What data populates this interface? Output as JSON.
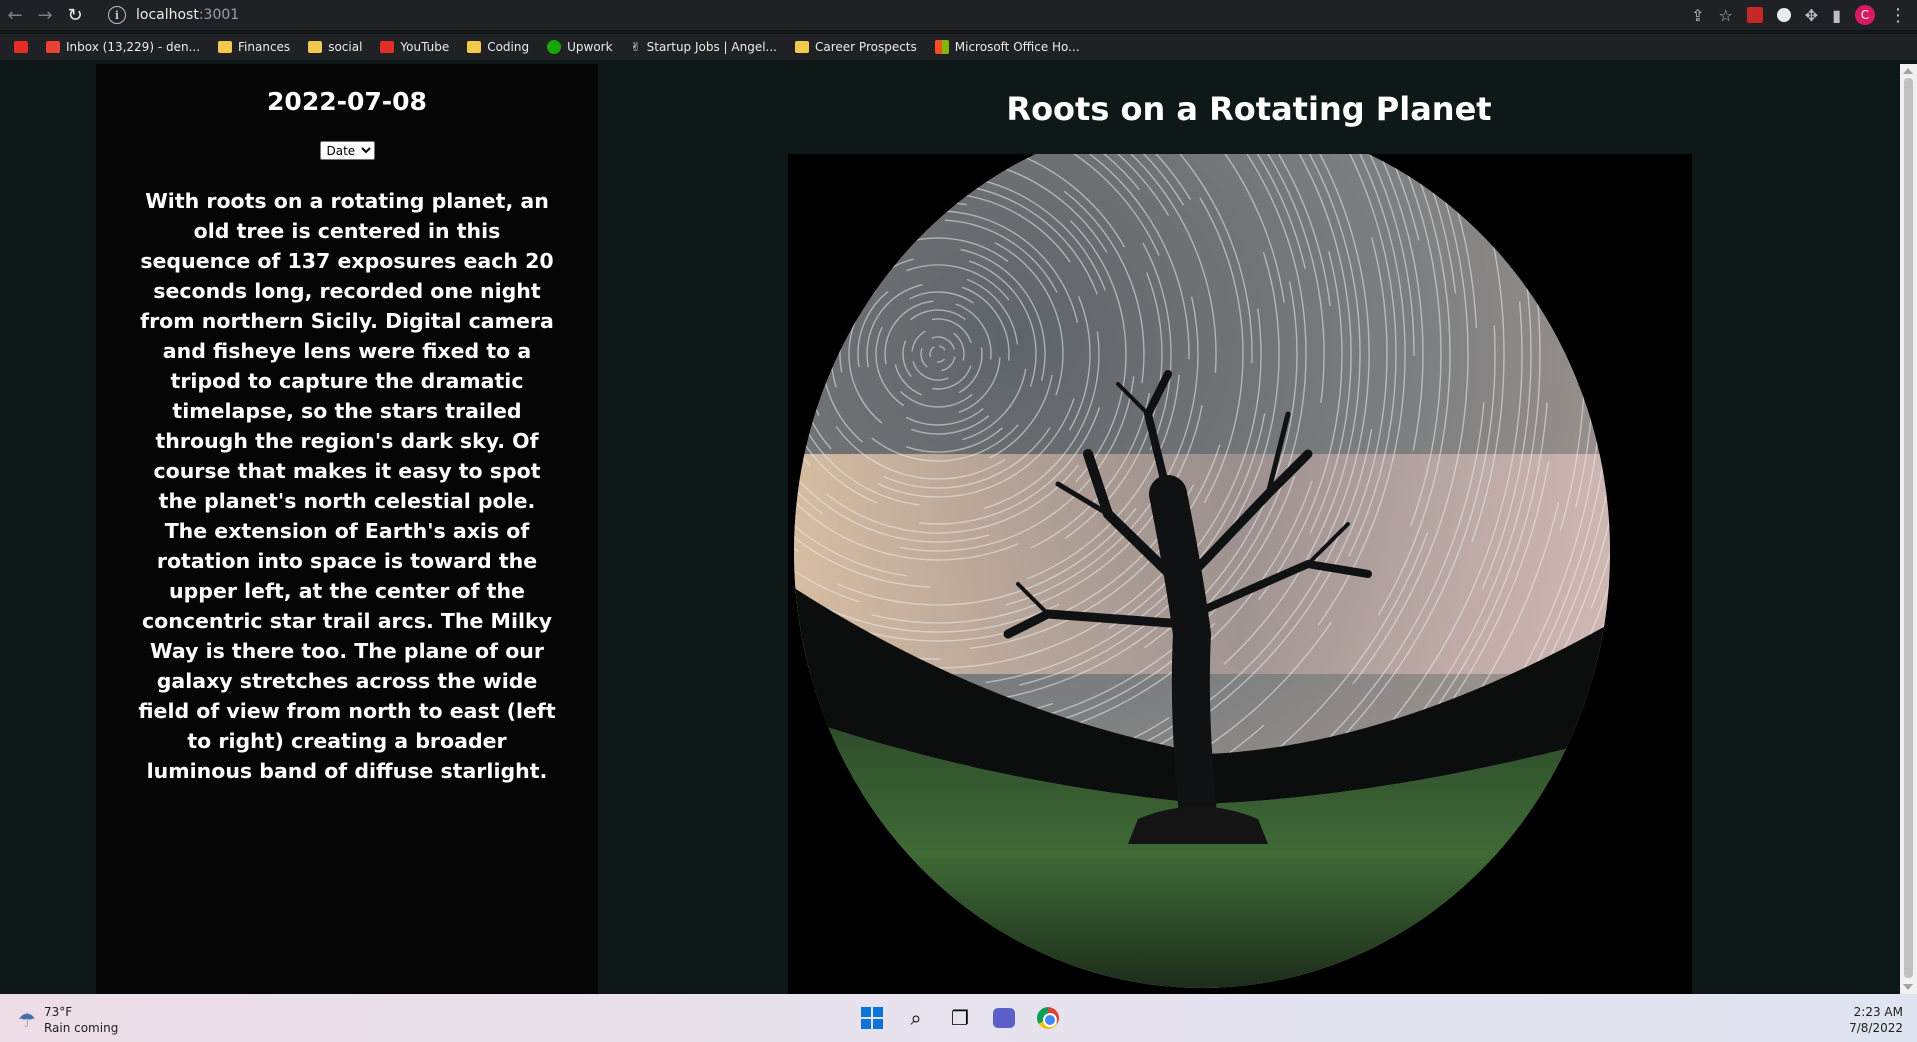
{
  "browser": {
    "url_host": "localhost",
    "url_port": ":3001",
    "profile_initial": "C"
  },
  "bookmarks": [
    {
      "label": "",
      "icon": "youtube-icon"
    },
    {
      "label": "Inbox (13,229) - den...",
      "icon": "gmail-icon"
    },
    {
      "label": "Finances",
      "icon": "folder-icon"
    },
    {
      "label": "social",
      "icon": "folder-icon"
    },
    {
      "label": "YouTube",
      "icon": "youtube-icon"
    },
    {
      "label": "Coding",
      "icon": "folder-icon"
    },
    {
      "label": "Upwork",
      "icon": "upwork-icon"
    },
    {
      "label": "Startup Jobs | Angel...",
      "icon": "angellist-icon"
    },
    {
      "label": "Career Prospects",
      "icon": "folder-icon"
    },
    {
      "label": "Microsoft Office Ho...",
      "icon": "microsoft-icon"
    }
  ],
  "sidebar": {
    "date": "2022-07-08",
    "select_label": "Date",
    "description": "With roots on a rotating planet, an old tree is centered in this sequence of 137 exposures each 20 seconds long, recorded one night from northern Sicily. Digital camera and fisheye lens were fixed to a tripod to capture the dramatic timelapse, so the stars trailed through the region's dark sky. Of course that makes it easy to spot the planet's north celestial pole. The extension of Earth's axis of rotation into space is toward the upper left, at the center of the concentric star trail arcs. The Milky Way is there too. The plane of our galaxy stretches across the wide field of view from north to east (left to right) creating a broader luminous band of diffuse starlight."
  },
  "main": {
    "title": "Roots on a Rotating Planet"
  },
  "taskbar": {
    "temperature": "73°F",
    "weather_text": "Rain coming",
    "time": "2:23 AM",
    "date": "7/8/2022"
  }
}
